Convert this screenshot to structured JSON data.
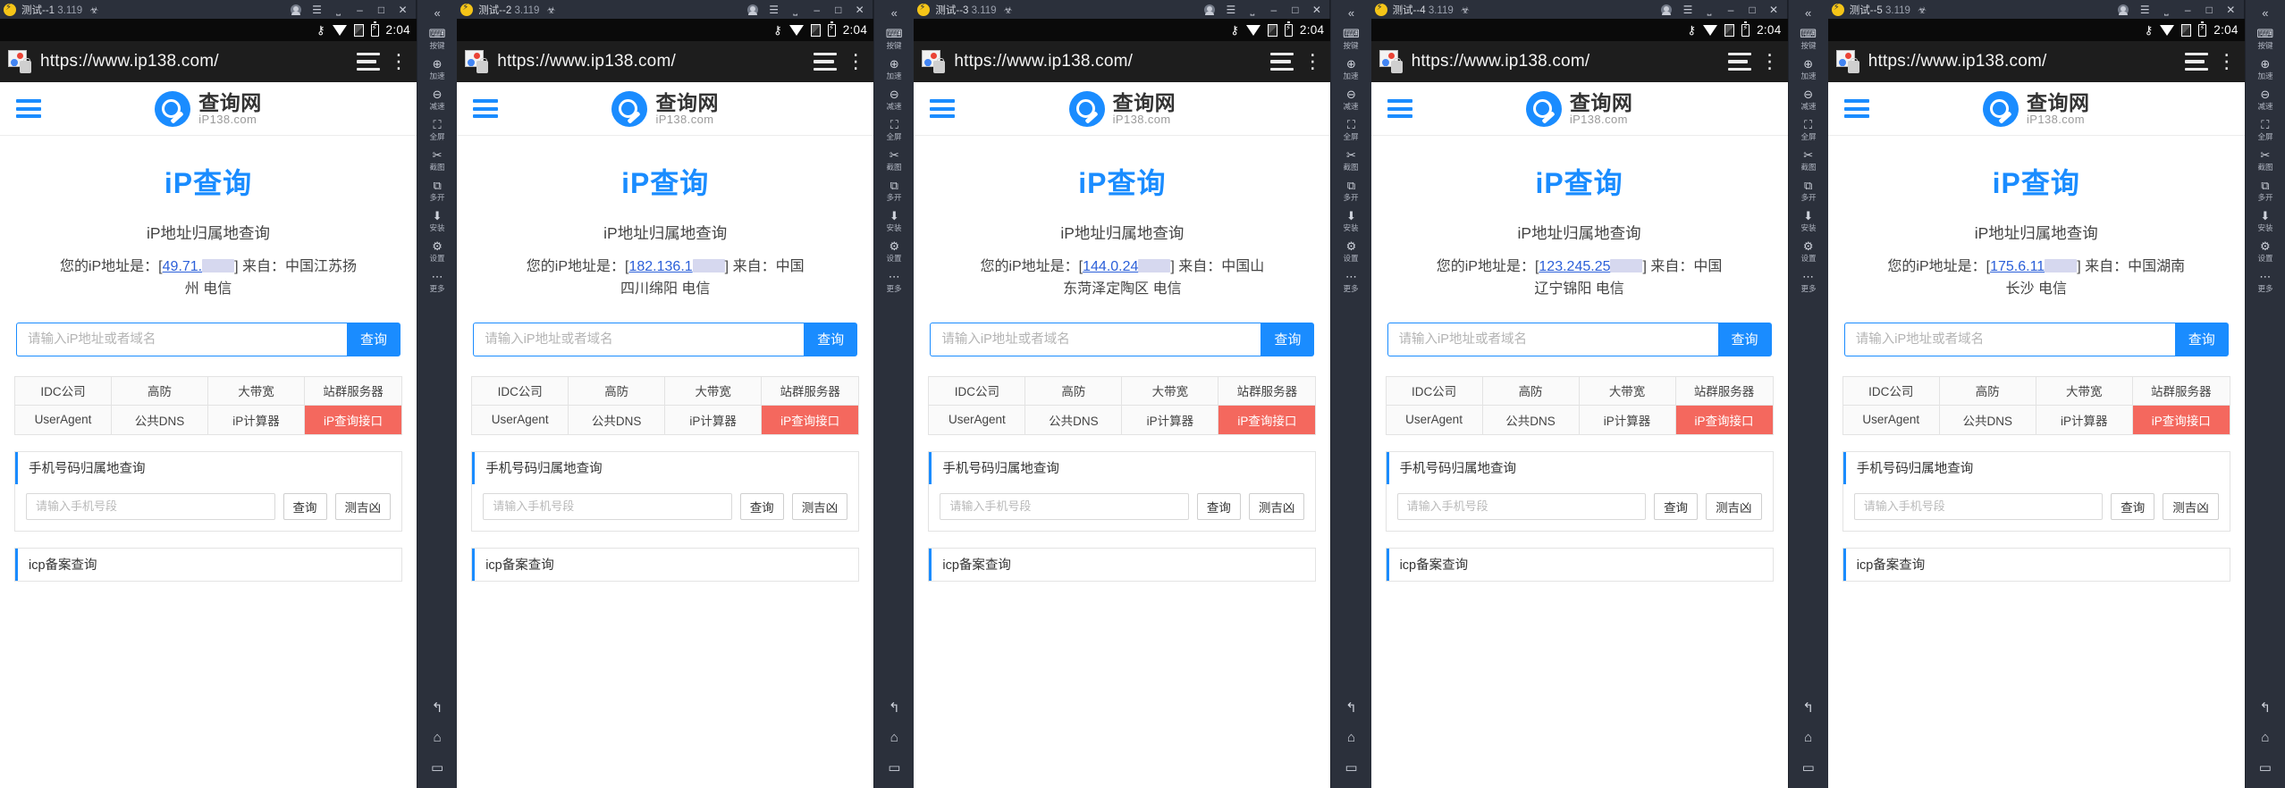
{
  "windows": [
    {
      "title_main": "测试--1",
      "title_ver": "3.119",
      "time": "2:04",
      "url": "https://www.ip138.com/",
      "ip_prefix": "49.71.",
      "region_line1": "您的iP地址是：[",
      "region_mid": "] 来自：中国江苏扬",
      "region_line2": "州 电信"
    },
    {
      "title_main": "测试--2",
      "title_ver": "3.119",
      "time": "2:04",
      "url": "https://www.ip138.com/",
      "ip_prefix": "182.136.1",
      "region_line1": "您的iP地址是：[",
      "region_mid": "] 来自：中国",
      "region_line2": "四川绵阳 电信"
    },
    {
      "title_main": "测试--3",
      "title_ver": "3.119",
      "time": "2:04",
      "url": "https://www.ip138.com/",
      "ip_prefix": "144.0.24",
      "region_line1": "您的iP地址是：[",
      "region_mid": "] 来自：中国山",
      "region_line2": "东菏泽定陶区 电信"
    },
    {
      "title_main": "测试--4",
      "title_ver": "3.119",
      "time": "2:04",
      "url": "https://www.ip138.com/",
      "ip_prefix": "123.245.25",
      "region_line1": "您的iP地址是：[",
      "region_mid": "] 来自：中国",
      "region_line2": "辽宁锦阳 电信"
    },
    {
      "title_main": "测试--5",
      "title_ver": "3.119",
      "time": "2:04",
      "url": "https://www.ip138.com/",
      "ip_prefix": "175.6.11",
      "region_line1": "您的iP地址是：[",
      "region_mid": "] 来自：中国湖南",
      "region_line2": "长沙 电信"
    }
  ],
  "titlebar_icons": [
    "avatar-icon",
    "menu-icon",
    "restore-icon",
    "minimize-icon",
    "maximize-icon",
    "close-icon"
  ],
  "status_icons": [
    "vpn-key-icon",
    "wifi-icon",
    "sim-icon",
    "battery-charging-icon"
  ],
  "browser": {
    "favicon": "site-image-lock-icon",
    "menu": "reader-mode-icon",
    "overflow": "⋮"
  },
  "site": {
    "menu_icon": "hamburger-menu-icon",
    "brand_name": "查询网",
    "brand_sub": "iP138.com",
    "heading": "iP查询",
    "subheading": "iP地址归属地查询",
    "search_placeholder": "请输入iP地址或者域名",
    "search_button": "查询",
    "tags_row1": [
      "IDC公司",
      "高防",
      "大带宽",
      "站群服务器"
    ],
    "tags_row2": [
      "UserAgent",
      "公共DNS",
      "iP计算器",
      "iP查询接口"
    ],
    "accent_tag": "iP查询接口",
    "accent_color": "#f4685e",
    "brand_color": "#1a8cff",
    "card_phone": {
      "title": "手机号码归属地查询",
      "placeholder": "请输入手机号段",
      "btn_query": "查询",
      "btn_luck": "测吉凶"
    },
    "card_icp": {
      "title": "icp备案查询"
    }
  },
  "rail": {
    "chevron": "«",
    "items": [
      {
        "glyph": "⌨",
        "label": "按键",
        "name": "key-tool"
      },
      {
        "glyph": "⊕",
        "label": "加速",
        "name": "speed-up-tool"
      },
      {
        "glyph": "⊖",
        "label": "减速",
        "name": "slow-down-tool"
      },
      {
        "glyph": "⛶",
        "label": "全屏",
        "name": "fullscreen-tool"
      },
      {
        "glyph": "✂",
        "label": "截图",
        "name": "screenshot-tool"
      },
      {
        "glyph": "⧉",
        "label": "多开",
        "name": "multi-open-tool"
      },
      {
        "glyph": "⬇",
        "label": "安装",
        "name": "install-tool"
      },
      {
        "glyph": "⚙",
        "label": "设置",
        "name": "settings-tool"
      },
      {
        "glyph": "⋯",
        "label": "更多",
        "name": "more-tool"
      }
    ],
    "nav": [
      {
        "glyph": "↰",
        "name": "back-nav"
      },
      {
        "glyph": "⌂",
        "name": "home-nav"
      },
      {
        "glyph": "▭",
        "name": "recents-nav"
      }
    ]
  }
}
